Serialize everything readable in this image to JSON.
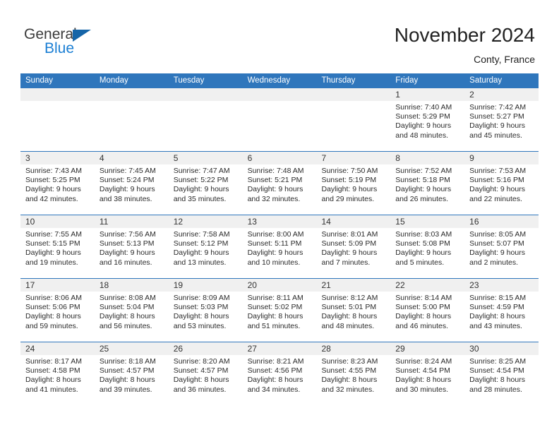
{
  "brand": {
    "name_part1": "General",
    "name_part2": "Blue",
    "accent_color": "#1b7fd4",
    "triangle_color": "#1565a8"
  },
  "header": {
    "title": "November 2024",
    "subtitle": "Conty, France"
  },
  "calendar": {
    "header_bg": "#2f76bc",
    "day_number_bg": "#f0f0f0",
    "weekdays": [
      "Sunday",
      "Monday",
      "Tuesday",
      "Wednesday",
      "Thursday",
      "Friday",
      "Saturday"
    ],
    "labels": {
      "sunrise": "Sunrise:",
      "sunset": "Sunset:",
      "daylight": "Daylight:"
    },
    "weeks": [
      [
        {
          "day": "",
          "empty": true
        },
        {
          "day": "",
          "empty": true
        },
        {
          "day": "",
          "empty": true
        },
        {
          "day": "",
          "empty": true
        },
        {
          "day": "",
          "empty": true
        },
        {
          "day": "1",
          "sunrise": "Sunrise: 7:40 AM",
          "sunset": "Sunset: 5:29 PM",
          "daylight_line1": "Daylight: 9 hours",
          "daylight_line2": "and 48 minutes."
        },
        {
          "day": "2",
          "sunrise": "Sunrise: 7:42 AM",
          "sunset": "Sunset: 5:27 PM",
          "daylight_line1": "Daylight: 9 hours",
          "daylight_line2": "and 45 minutes."
        }
      ],
      [
        {
          "day": "3",
          "sunrise": "Sunrise: 7:43 AM",
          "sunset": "Sunset: 5:25 PM",
          "daylight_line1": "Daylight: 9 hours",
          "daylight_line2": "and 42 minutes."
        },
        {
          "day": "4",
          "sunrise": "Sunrise: 7:45 AM",
          "sunset": "Sunset: 5:24 PM",
          "daylight_line1": "Daylight: 9 hours",
          "daylight_line2": "and 38 minutes."
        },
        {
          "day": "5",
          "sunrise": "Sunrise: 7:47 AM",
          "sunset": "Sunset: 5:22 PM",
          "daylight_line1": "Daylight: 9 hours",
          "daylight_line2": "and 35 minutes."
        },
        {
          "day": "6",
          "sunrise": "Sunrise: 7:48 AM",
          "sunset": "Sunset: 5:21 PM",
          "daylight_line1": "Daylight: 9 hours",
          "daylight_line2": "and 32 minutes."
        },
        {
          "day": "7",
          "sunrise": "Sunrise: 7:50 AM",
          "sunset": "Sunset: 5:19 PM",
          "daylight_line1": "Daylight: 9 hours",
          "daylight_line2": "and 29 minutes."
        },
        {
          "day": "8",
          "sunrise": "Sunrise: 7:52 AM",
          "sunset": "Sunset: 5:18 PM",
          "daylight_line1": "Daylight: 9 hours",
          "daylight_line2": "and 26 minutes."
        },
        {
          "day": "9",
          "sunrise": "Sunrise: 7:53 AM",
          "sunset": "Sunset: 5:16 PM",
          "daylight_line1": "Daylight: 9 hours",
          "daylight_line2": "and 22 minutes."
        }
      ],
      [
        {
          "day": "10",
          "sunrise": "Sunrise: 7:55 AM",
          "sunset": "Sunset: 5:15 PM",
          "daylight_line1": "Daylight: 9 hours",
          "daylight_line2": "and 19 minutes."
        },
        {
          "day": "11",
          "sunrise": "Sunrise: 7:56 AM",
          "sunset": "Sunset: 5:13 PM",
          "daylight_line1": "Daylight: 9 hours",
          "daylight_line2": "and 16 minutes."
        },
        {
          "day": "12",
          "sunrise": "Sunrise: 7:58 AM",
          "sunset": "Sunset: 5:12 PM",
          "daylight_line1": "Daylight: 9 hours",
          "daylight_line2": "and 13 minutes."
        },
        {
          "day": "13",
          "sunrise": "Sunrise: 8:00 AM",
          "sunset": "Sunset: 5:11 PM",
          "daylight_line1": "Daylight: 9 hours",
          "daylight_line2": "and 10 minutes."
        },
        {
          "day": "14",
          "sunrise": "Sunrise: 8:01 AM",
          "sunset": "Sunset: 5:09 PM",
          "daylight_line1": "Daylight: 9 hours",
          "daylight_line2": "and 7 minutes."
        },
        {
          "day": "15",
          "sunrise": "Sunrise: 8:03 AM",
          "sunset": "Sunset: 5:08 PM",
          "daylight_line1": "Daylight: 9 hours",
          "daylight_line2": "and 5 minutes."
        },
        {
          "day": "16",
          "sunrise": "Sunrise: 8:05 AM",
          "sunset": "Sunset: 5:07 PM",
          "daylight_line1": "Daylight: 9 hours",
          "daylight_line2": "and 2 minutes."
        }
      ],
      [
        {
          "day": "17",
          "sunrise": "Sunrise: 8:06 AM",
          "sunset": "Sunset: 5:06 PM",
          "daylight_line1": "Daylight: 8 hours",
          "daylight_line2": "and 59 minutes."
        },
        {
          "day": "18",
          "sunrise": "Sunrise: 8:08 AM",
          "sunset": "Sunset: 5:04 PM",
          "daylight_line1": "Daylight: 8 hours",
          "daylight_line2": "and 56 minutes."
        },
        {
          "day": "19",
          "sunrise": "Sunrise: 8:09 AM",
          "sunset": "Sunset: 5:03 PM",
          "daylight_line1": "Daylight: 8 hours",
          "daylight_line2": "and 53 minutes."
        },
        {
          "day": "20",
          "sunrise": "Sunrise: 8:11 AM",
          "sunset": "Sunset: 5:02 PM",
          "daylight_line1": "Daylight: 8 hours",
          "daylight_line2": "and 51 minutes."
        },
        {
          "day": "21",
          "sunrise": "Sunrise: 8:12 AM",
          "sunset": "Sunset: 5:01 PM",
          "daylight_line1": "Daylight: 8 hours",
          "daylight_line2": "and 48 minutes."
        },
        {
          "day": "22",
          "sunrise": "Sunrise: 8:14 AM",
          "sunset": "Sunset: 5:00 PM",
          "daylight_line1": "Daylight: 8 hours",
          "daylight_line2": "and 46 minutes."
        },
        {
          "day": "23",
          "sunrise": "Sunrise: 8:15 AM",
          "sunset": "Sunset: 4:59 PM",
          "daylight_line1": "Daylight: 8 hours",
          "daylight_line2": "and 43 minutes."
        }
      ],
      [
        {
          "day": "24",
          "sunrise": "Sunrise: 8:17 AM",
          "sunset": "Sunset: 4:58 PM",
          "daylight_line1": "Daylight: 8 hours",
          "daylight_line2": "and 41 minutes."
        },
        {
          "day": "25",
          "sunrise": "Sunrise: 8:18 AM",
          "sunset": "Sunset: 4:57 PM",
          "daylight_line1": "Daylight: 8 hours",
          "daylight_line2": "and 39 minutes."
        },
        {
          "day": "26",
          "sunrise": "Sunrise: 8:20 AM",
          "sunset": "Sunset: 4:57 PM",
          "daylight_line1": "Daylight: 8 hours",
          "daylight_line2": "and 36 minutes."
        },
        {
          "day": "27",
          "sunrise": "Sunrise: 8:21 AM",
          "sunset": "Sunset: 4:56 PM",
          "daylight_line1": "Daylight: 8 hours",
          "daylight_line2": "and 34 minutes."
        },
        {
          "day": "28",
          "sunrise": "Sunrise: 8:23 AM",
          "sunset": "Sunset: 4:55 PM",
          "daylight_line1": "Daylight: 8 hours",
          "daylight_line2": "and 32 minutes."
        },
        {
          "day": "29",
          "sunrise": "Sunrise: 8:24 AM",
          "sunset": "Sunset: 4:54 PM",
          "daylight_line1": "Daylight: 8 hours",
          "daylight_line2": "and 30 minutes."
        },
        {
          "day": "30",
          "sunrise": "Sunrise: 8:25 AM",
          "sunset": "Sunset: 4:54 PM",
          "daylight_line1": "Daylight: 8 hours",
          "daylight_line2": "and 28 minutes."
        }
      ]
    ]
  }
}
